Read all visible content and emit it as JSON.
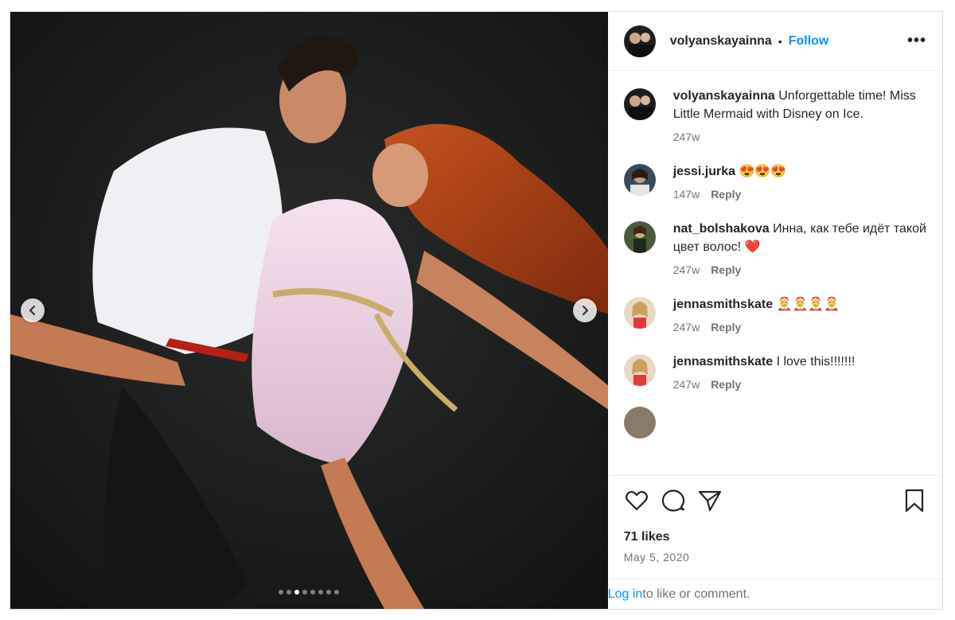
{
  "header": {
    "username": "volyanskayainna",
    "separator": "•",
    "follow_label": "Follow",
    "more_icon": "more-horizontal-icon",
    "more_label": "•••"
  },
  "caption": {
    "username": "volyanskayainna",
    "text": "Unforgettable time! Miss Little Mermaid with Disney on Ice.",
    "time": "247w"
  },
  "comments": [
    {
      "username": "jessi.jurka",
      "text": "😍😍😍",
      "time": "147w",
      "reply_label": "Reply"
    },
    {
      "username": "nat_bolshakova",
      "text": "Инна, как тебе идёт такой цвет волос! ❤️",
      "time": "247w",
      "reply_label": "Reply"
    },
    {
      "username": "jennasmithskate",
      "text": "🤶🤶🤶🤶",
      "time": "247w",
      "reply_label": "Reply"
    },
    {
      "username": "jennasmithskate",
      "text": "I love this!!!!!!!",
      "time": "247w",
      "reply_label": "Reply"
    }
  ],
  "carousel": {
    "total_slides": 8,
    "active_slide": 3
  },
  "actions": {
    "likes": "71 likes",
    "date": "May 5, 2020"
  },
  "login": {
    "link_label": "Log in",
    "rest_text": " to like or comment."
  }
}
